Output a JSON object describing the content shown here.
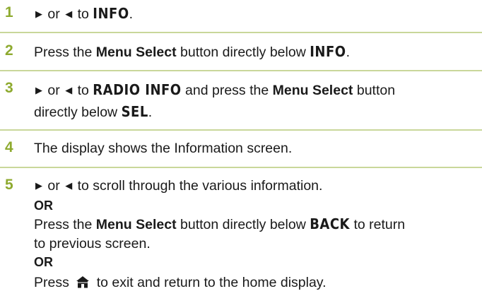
{
  "step1": {
    "num": "1",
    "or": "or",
    "to": "to",
    "target": "INFO",
    "period": "."
  },
  "step2": {
    "num": "2",
    "press": "Press the",
    "button": "Menu Select",
    "rest": "button directly below",
    "target": "INFO",
    "period": "."
  },
  "step3": {
    "num": "3",
    "or": "or",
    "to": "to",
    "target": "RADIO INFO",
    "and_press": "and press the",
    "button": "Menu Select",
    "rest": "button",
    "line2": "directly below",
    "target2": "SEL",
    "period": "."
  },
  "step4": {
    "num": "4",
    "text": "The display shows the Information screen."
  },
  "step5": {
    "num": "5",
    "or": "or",
    "scroll": "to scroll through the various information.",
    "or_label_1": "OR",
    "press": "Press the",
    "button": "Menu Select",
    "rest": "button directly below",
    "target": "BACK",
    "return": "to return",
    "line_cont": "to previous screen.",
    "or_label_2": "OR",
    "press_home": "Press",
    "exit": "to exit and return to the home display."
  },
  "icons": {
    "right": "right-arrow-icon",
    "left": "left-arrow-icon",
    "home": "home-icon"
  },
  "colors": {
    "step_number": "#8eaa2f",
    "divider": "#c9d79a",
    "text": "#1a1a1a"
  }
}
